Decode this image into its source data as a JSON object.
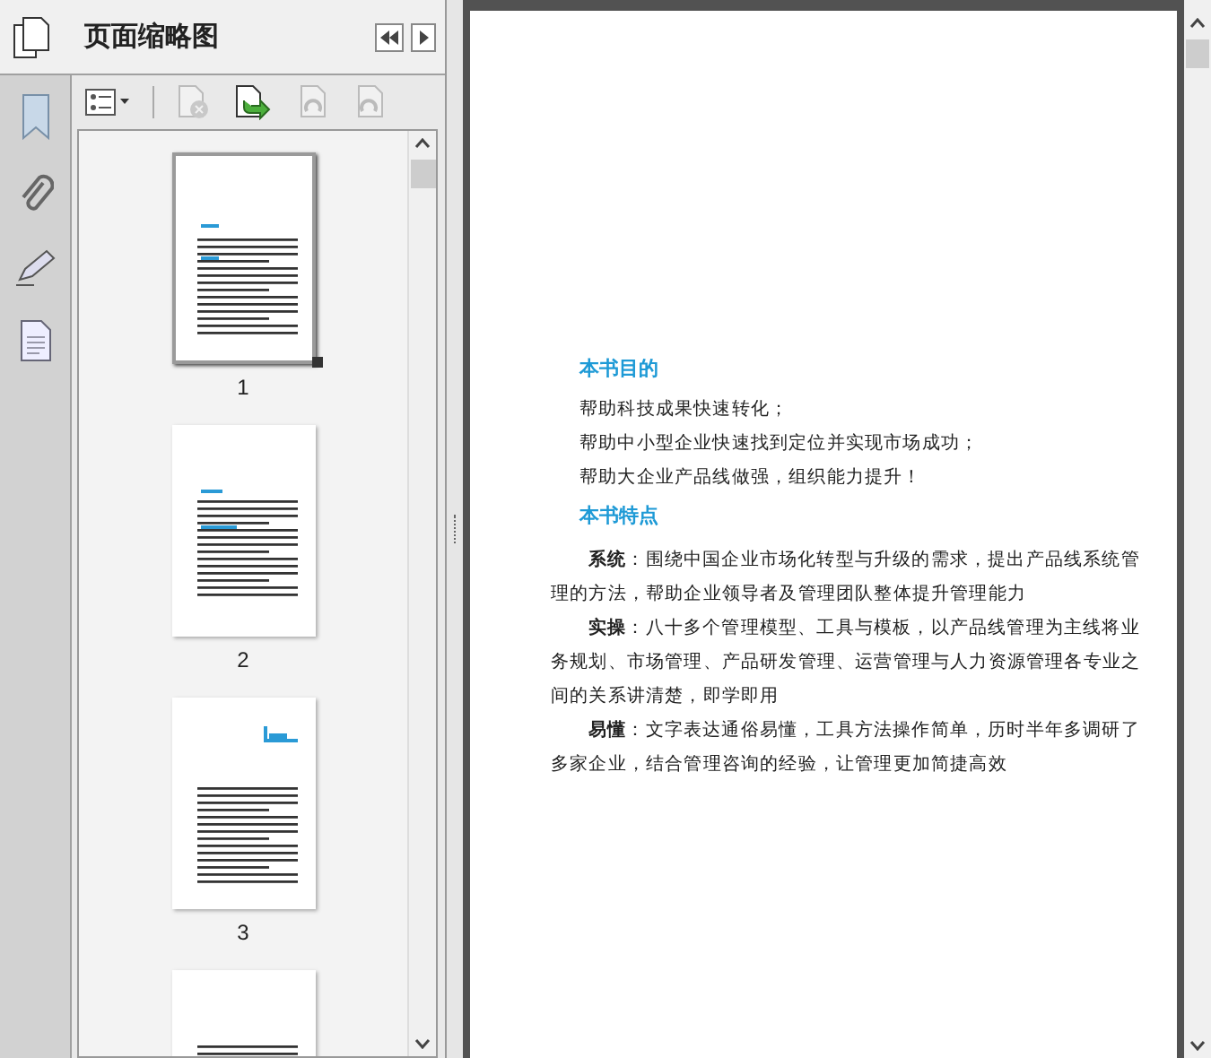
{
  "panel": {
    "title": "页面缩略图"
  },
  "toolbar": [
    {
      "kind": "options",
      "disabled": false
    },
    {
      "kind": "delete",
      "disabled": true
    },
    {
      "kind": "insert",
      "disabled": false
    },
    {
      "kind": "rotate-left",
      "disabled": true
    },
    {
      "kind": "rotate-right",
      "disabled": true
    }
  ],
  "thumbnails": [
    {
      "label": "1",
      "selected": true
    },
    {
      "label": "2",
      "selected": false
    },
    {
      "label": "3",
      "selected": false
    },
    {
      "selected": false
    }
  ],
  "document": {
    "sections": [
      {
        "heading": "本书目的",
        "kind": "list",
        "lines": [
          "帮助科技成果快速转化；",
          "帮助中小型企业快速找到定位并实现市场成功；",
          "帮助大企业产品线做强，组织能力提升！"
        ]
      },
      {
        "heading": "本书特点",
        "kind": "paragraphs",
        "lines": [
          "**系统**：围绕中国企业市场化转型与升级的需求，提出产品线系统管理的方法，帮助企业领导者及管理团队整体提升管理能力",
          "**实操**：八十多个管理模型、工具与模板，以产品线管理为主线将业务规划、市场管理、产品研发管理、运营管理与人力资源管理各专业之间的关系讲清楚，即学即用",
          "**易懂**：文字表达通俗易懂，工具方法操作简单，历时半年多调研了多家企业，结合管理咨询的经验，让管理更加简捷高效"
        ]
      }
    ]
  }
}
